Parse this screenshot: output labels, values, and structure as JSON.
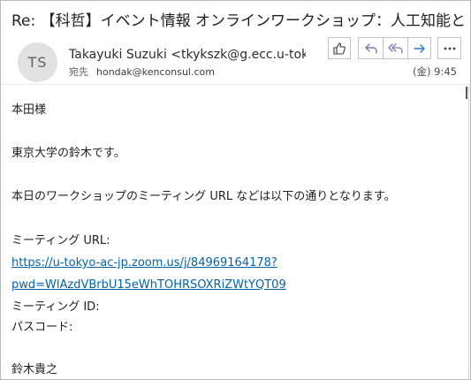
{
  "email": {
    "subject": "Re: 【科哲】イベント情報 オンラインワークショップ：人工知能と徳",
    "avatar_initials": "TS",
    "sender": "Takayuki Suzuki <tkykszk@g.ecc.u-tok",
    "to_label": "宛先",
    "to_address": "hondak@kenconsul.com",
    "datetime": "(金) 9:45"
  },
  "toolbar": {
    "like_icon": "thumbs-up-icon",
    "reply_icon": "reply-icon",
    "reply_all_icon": "reply-all-icon",
    "forward_icon": "forward-icon",
    "more_icon": "more-icon"
  },
  "body": {
    "greeting": "本田様",
    "intro": "東京大学の鈴木です。",
    "message": "本日のワークショップのミーティング URL などは以下の通りとなります。",
    "meeting_url_label": "ミーティング URL:",
    "meeting_url_line1": "https://u-tokyo-ac-jp.zoom.us/j/84969164178?",
    "meeting_url_line2": "pwd=WlAzdVBrbU15eWhTOHRSOXRiZWtYQT09",
    "meeting_id_label": "ミーティング ID:",
    "passcode_label": "パスコード:",
    "signature": "鈴木貴之"
  },
  "colors": {
    "link": "#0563a8",
    "button_icon": "#8a6fb0",
    "forward_icon": "#2d77c7"
  }
}
